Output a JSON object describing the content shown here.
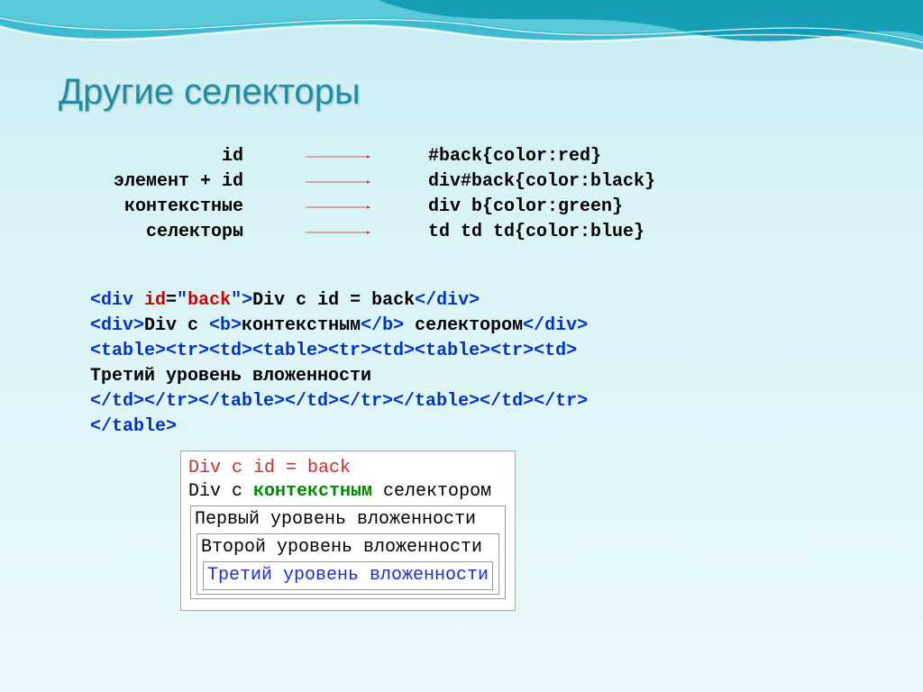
{
  "title": "Другие селекторы",
  "rows": [
    {
      "label": "id",
      "code": "#back{color:red}"
    },
    {
      "label": "элемент + id",
      "code": "div#back{color:black}"
    },
    {
      "label": "контекстные",
      "code": "div b{color:green}"
    },
    {
      "label": "селекторы",
      "code": "td td td{color:blue}"
    }
  ],
  "code": {
    "line1_open": "<div ",
    "line1_attr": "id",
    "line1_eq": "=",
    "line1_q1": "\"",
    "line1_val": "back",
    "line1_q2": "\"",
    "line1_close": ">",
    "line1_text": "Div с id = back",
    "line1_end": "</div>",
    "line2_open": "<div>",
    "line2_t1": "Div с ",
    "line2_bopen": "<b>",
    "line2_bt": "контекстным",
    "line2_bclose": "</b>",
    "line2_t2": " селектором",
    "line2_end": "</div>",
    "line3": "<table><tr><td><table><tr><td><table><tr><td>",
    "line4": "Третий уровень вложенности",
    "line5": "</td></tr></table></td></tr></table></td></tr>",
    "line6": "</table>"
  },
  "result": {
    "line1": "Div с id = back",
    "line2_a": "Div с ",
    "line2_b": "контекстным",
    "line2_c": " селектором",
    "nest1": "Первый уровень вложенности",
    "nest2": "Второй уровень вложенности",
    "nest3": "Третий уровень вложенности"
  },
  "colors": {
    "arrow": "#c82a2a",
    "title": "#1f8ea3"
  }
}
